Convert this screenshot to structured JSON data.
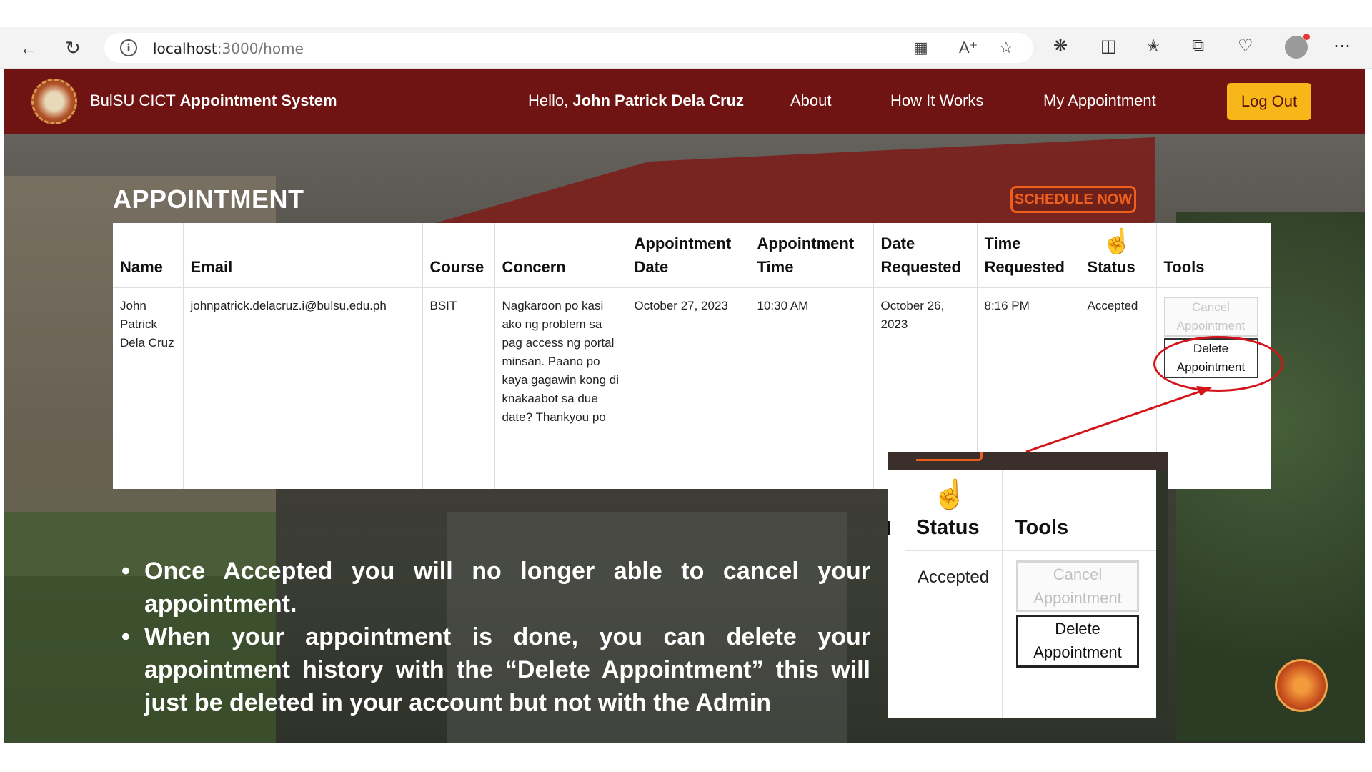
{
  "browser": {
    "url_host": "localhost",
    "url_rest": ":3000/home"
  },
  "navbar": {
    "brand_prefix": "BulSU CICT",
    "brand_bold": "Appointment System",
    "hello_prefix": "Hello,",
    "hello_name": "John Patrick Dela Cruz",
    "links": [
      "About",
      "How It Works",
      "My Appointment"
    ],
    "logout": "Log Out",
    "color": "#6f1412",
    "logout_color": "#f7b718"
  },
  "main": {
    "title": "APPOINTMENT",
    "schedule_button": "SCHEDULE NOW",
    "table": {
      "headers": [
        "Name",
        "Email",
        "Course",
        "Concern",
        "Appointment Date",
        "Appointment Time",
        "Date Requested",
        "Time Requested",
        "Status",
        "Tools"
      ],
      "row": {
        "name": "John Patrick Dela Cruz",
        "email": "johnpatrick.delacruz.i@bulsu.edu.ph",
        "course": "BSIT",
        "concern": "Nagkaroon po kasi ako ng problem sa pag access ng portal minsan. Paano po kaya gagawin kong di knakaabot sa due date? Thankyou po",
        "appointment_date": "October 27, 2023",
        "appointment_time": "10:30 AM",
        "date_requested": "October 26, 2023",
        "time_requested": "8:16 PM",
        "status": "Accepted",
        "cancel_button": "Cancel Appointment",
        "delete_button": "Delete Appointment"
      }
    }
  },
  "zoom": {
    "fragment": "l",
    "status_header": "Status",
    "tools_header": "Tools",
    "status_value": "Accepted",
    "cancel_button": "Cancel Appointment",
    "delete_button": "Delete Appointment"
  },
  "notes": [
    "Once Accepted you will no longer able to cancel your appointment.",
    "When your appointment is done, you can delete your appointment history with the “Delete Appointment” this will just be deleted in your account but not with the Admin"
  ],
  "icons": {
    "back": "arrow-left-icon",
    "refresh": "refresh-icon",
    "info": "info-icon",
    "hand": "hand-pointer-icon"
  },
  "annotation_color": "#d2151a"
}
